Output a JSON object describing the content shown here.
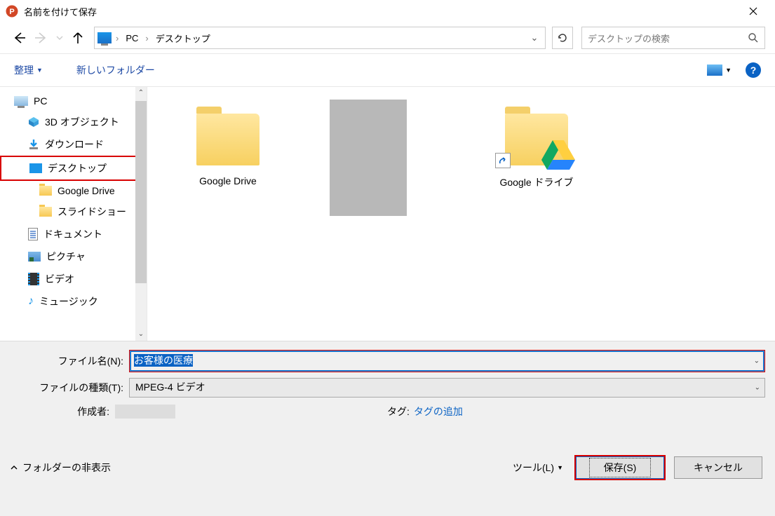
{
  "window": {
    "title": "名前を付けて保存"
  },
  "nav": {
    "breadcrumb": {
      "pc": "PC",
      "desktop": "デスクトップ"
    },
    "search_placeholder": "デスクトップの検索"
  },
  "toolbar": {
    "organize": "整理",
    "new_folder": "新しいフォルダー"
  },
  "tree": {
    "pc": "PC",
    "objects3d": "3D オブジェクト",
    "downloads": "ダウンロード",
    "desktop": "デスクトップ",
    "google_drive": "Google Drive",
    "slideshow": "スライドショー",
    "documents": "ドキュメント",
    "pictures": "ピクチャ",
    "videos": "ビデオ",
    "music": "ミュージック"
  },
  "content": {
    "item1": "Google Drive",
    "item3": "Google ドライブ"
  },
  "form": {
    "filename_label": "ファイル名(N):",
    "filename_value": "お客様の医療",
    "filetype_label": "ファイルの種類(T):",
    "filetype_value": "MPEG-4 ビデオ",
    "author_label": "作成者:",
    "tags_label": "タグ:",
    "tags_add": "タグの追加"
  },
  "buttons": {
    "hide_folders": "フォルダーの非表示",
    "tools": "ツール(L)",
    "save": "保存(S)",
    "cancel": "キャンセル"
  }
}
